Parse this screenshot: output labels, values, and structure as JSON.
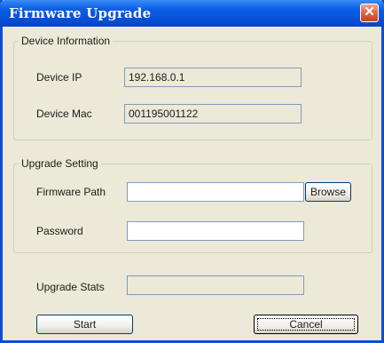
{
  "window": {
    "title": "Firmware Upgrade"
  },
  "device_info": {
    "group_label": "Device Information",
    "ip_label": "Device IP",
    "ip_value": "192.168.0.1",
    "mac_label": "Device Mac",
    "mac_value": "001195001122"
  },
  "upgrade_setting": {
    "group_label": "Upgrade Setting",
    "path_label": "Firmware Path",
    "path_value": "",
    "browse_label": "Browse",
    "password_label": "Password",
    "password_value": ""
  },
  "status": {
    "label": "Upgrade Stats",
    "value": ""
  },
  "buttons": {
    "start_label": "Start",
    "cancel_label": "Cancel"
  }
}
